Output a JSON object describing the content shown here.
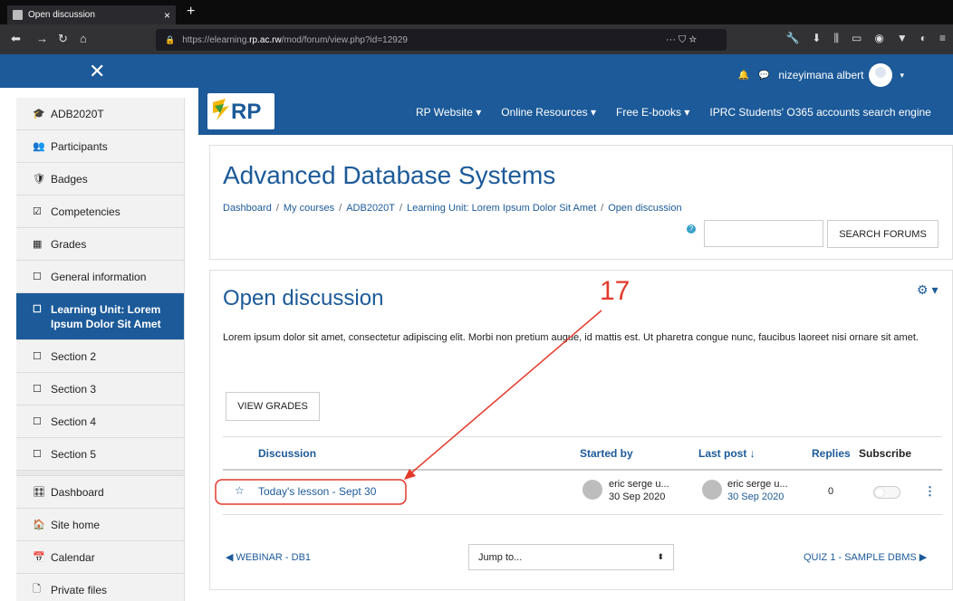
{
  "browser": {
    "tab_title": "Open discussion",
    "tab_close": "×",
    "new_tab": "+",
    "url_prefix": "https://elearning.",
    "url_host": "rp.ac.rw",
    "url_path": "/mod/forum/view.php?id=12929",
    "url_actions": "··· ⛉ ☆"
  },
  "navbar": {
    "close_icon": "✕",
    "username": "nizeyimana albert",
    "bell_icon": "🔔",
    "chat_icon": "💬"
  },
  "site_menu": [
    {
      "label": "RP Website ▾"
    },
    {
      "label": "Online Resources ▾"
    },
    {
      "label": "Free E-books ▾"
    },
    {
      "label": "IPRC Students' O365 accounts search engine"
    }
  ],
  "sidebar": {
    "items": [
      {
        "icon": "🎓",
        "label": "ADB2020T"
      },
      {
        "icon": "👥",
        "label": "Participants"
      },
      {
        "icon": "🛡",
        "label": "Badges"
      },
      {
        "icon": "☑",
        "label": "Competencies"
      },
      {
        "icon": "▦",
        "label": "Grades"
      },
      {
        "icon": "☐",
        "label": "General information"
      },
      {
        "icon": "☐",
        "label": "Learning Unit: Lorem Ipsum Dolor Sit Amet"
      },
      {
        "icon": "☐",
        "label": "Section 2"
      },
      {
        "icon": "☐",
        "label": "Section 3"
      },
      {
        "icon": "☐",
        "label": "Section 4"
      },
      {
        "icon": "☐",
        "label": "Section 5"
      },
      {
        "icon": "🎛",
        "label": "Dashboard"
      },
      {
        "icon": "🏠",
        "label": "Site home"
      },
      {
        "icon": "📅",
        "label": "Calendar"
      },
      {
        "icon": "🗋",
        "label": "Private files"
      }
    ]
  },
  "header": {
    "course_title": "Advanced Database Systems",
    "breadcrumb": [
      "Dashboard",
      "My courses",
      "ADB2020T",
      "Learning Unit: Lorem Ipsum Dolor Sit Amet",
      "Open discussion"
    ],
    "breadcrumb_sep": "/",
    "search_button": "SEARCH FORUMS",
    "help": "?"
  },
  "forum": {
    "title": "Open discussion",
    "description": "Lorem ipsum dolor sit amet, consectetur adipiscing elit. Morbi non pretium augue, id mattis est. Ut pharetra congue nunc, faucibus laoreet nisi ornare sit amet.",
    "view_grades": "VIEW GRADES",
    "gear_icon": "⚙ ▾",
    "columns": {
      "discussion": "Discussion",
      "started_by": "Started by",
      "last_post": "Last post ↓",
      "replies": "Replies",
      "subscribe": "Subscribe"
    },
    "rows": [
      {
        "title": "Today's lesson - Sept 30",
        "started_by_name": "eric serge u...",
        "started_by_date": "30 Sep 2020",
        "last_post_name": "eric serge u...",
        "last_post_date": "30 Sep 2020",
        "replies": "0"
      }
    ],
    "prev_activity": "◀ WEBINAR - DB1",
    "jump_to": "Jump to...",
    "jump_caret": "⬍",
    "next_activity": "QUIZ 1 - SAMPLE DBMS ▶"
  },
  "annotation": {
    "label": "17",
    "color": "#e33a2a"
  }
}
